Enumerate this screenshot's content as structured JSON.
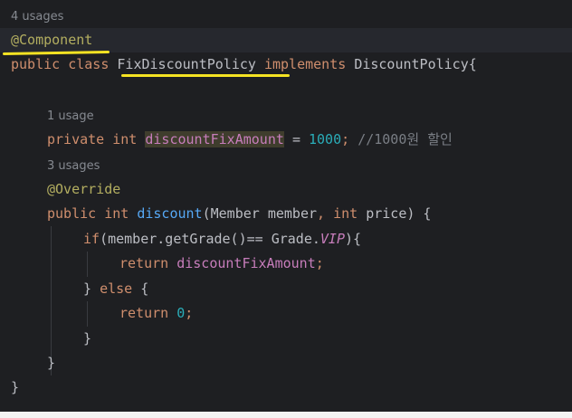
{
  "code": {
    "line1_hint": "4 usages",
    "line2_annotation": "@Component",
    "line3": {
      "kw_public": "public",
      "kw_class": "class",
      "class_name": "FixDiscountPolicy",
      "kw_implements": "implements",
      "interface_name": "DiscountPolicy{"
    },
    "line5_hint": "1 usage",
    "line6": {
      "kw_private": "private",
      "kw_int": "int",
      "field_name": "discountFixAmount",
      "equals": "=",
      "value": "1000",
      "semicolon": ";",
      "comment": "//1000원 할인"
    },
    "line7_hint": "3 usages",
    "line8_annotation": "@Override",
    "line9": {
      "kw_public": "public",
      "kw_int": "int",
      "method_name": "discount",
      "params_open": "(Member member",
      "comma": ",",
      "kw_int2": "int",
      "params_close": "price) {"
    },
    "line10": {
      "kw_if": "if",
      "cond_start": "(member.getGrade()== Grade.",
      "enum_value": "VIP",
      "cond_end": "){"
    },
    "line11": {
      "kw_return": "return",
      "field_ref": "discountFixAmount",
      "semicolon": ";"
    },
    "line12": {
      "brace_close": "}",
      "kw_else": "else",
      "brace_open": "{"
    },
    "line13": {
      "kw_return": "return",
      "value": "0",
      "semicolon": ";"
    },
    "line14_brace": "}",
    "line15_brace": "}",
    "line16_brace": "}"
  }
}
